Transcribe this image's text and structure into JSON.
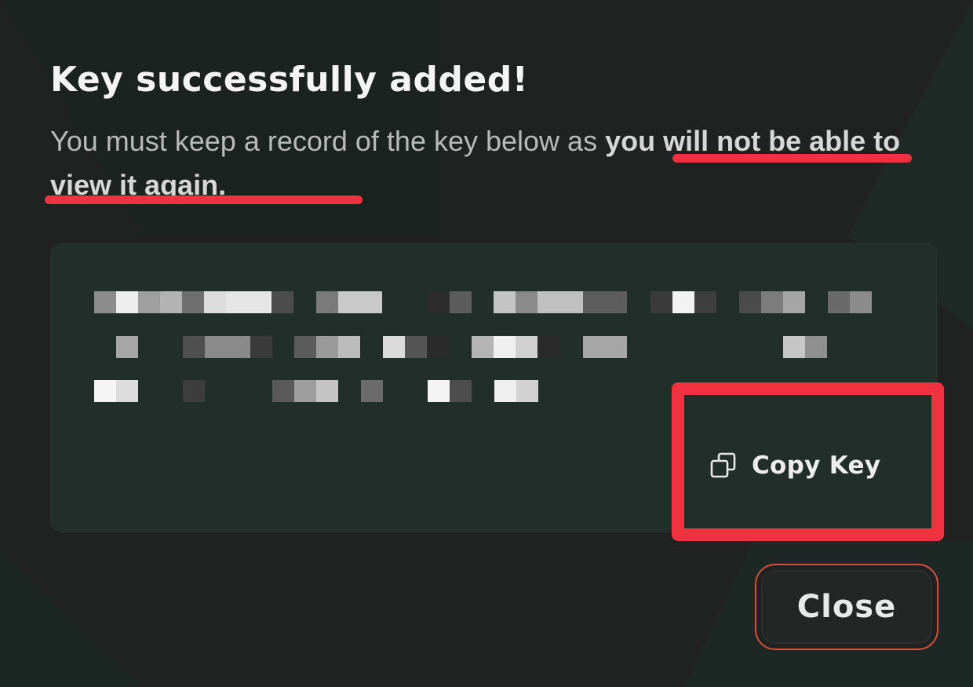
{
  "dialog": {
    "title": "Key successfully added!",
    "message_prefix": "You must keep a record of the key below as ",
    "message_emphasis": "you will not be able to view it again.",
    "key_value_visible": false,
    "copy_button_label": "Copy Key",
    "copy_icon": "copy-icon",
    "close_button_label": "Close"
  },
  "colors": {
    "background": "#1f2221",
    "key_box": "#212e2a",
    "annotation_red": "#f0313f",
    "close_border": "#d4513f",
    "title_text": "#f4f4f4",
    "body_text": "#b8bab9"
  }
}
